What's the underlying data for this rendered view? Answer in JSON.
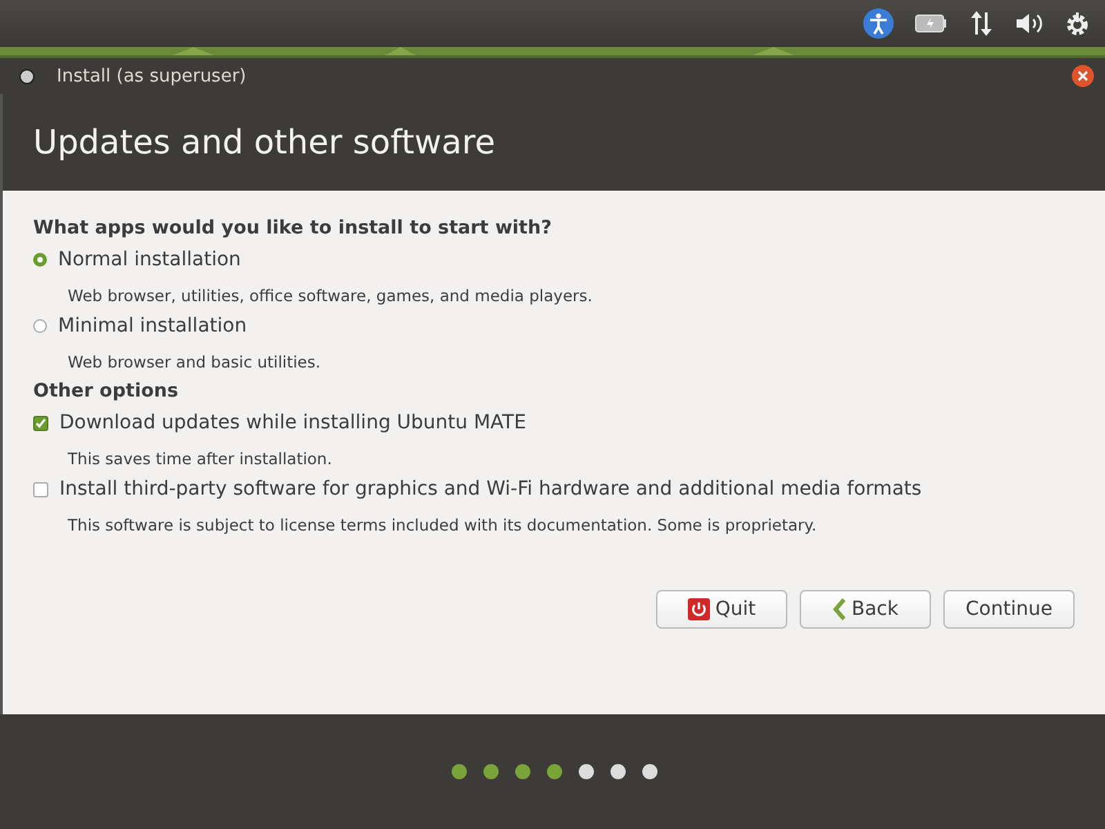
{
  "window": {
    "title": "Install (as superuser)"
  },
  "header": {
    "title": "Updates and other software"
  },
  "sections": [
    {
      "heading": "What apps would you like to install to start with?",
      "options": [
        {
          "kind": "radio",
          "label": "Normal installation",
          "selected": true,
          "description": "Web browser, utilities, office software, games, and media players."
        },
        {
          "kind": "radio",
          "label": "Minimal installation",
          "selected": false,
          "description": "Web browser and basic utilities."
        }
      ]
    },
    {
      "heading": "Other options",
      "options": [
        {
          "kind": "checkbox",
          "label": "Download updates while installing Ubuntu MATE",
          "checked": true,
          "description": "This saves time after installation."
        },
        {
          "kind": "checkbox",
          "label": "Install third-party software for graphics and Wi-Fi hardware and additional media formats",
          "checked": false,
          "description": "This software is subject to license terms included with its documentation. Some is proprietary."
        }
      ]
    }
  ],
  "buttons": [
    {
      "kind": "quit",
      "label": "Quit"
    },
    {
      "kind": "back",
      "label": "Back"
    },
    {
      "kind": "plain",
      "label": "Continue"
    }
  ],
  "steps": [
    {
      "done": true
    },
    {
      "done": true
    },
    {
      "done": true
    },
    {
      "done": true
    },
    {
      "done": false
    },
    {
      "done": false
    },
    {
      "done": false
    }
  ]
}
